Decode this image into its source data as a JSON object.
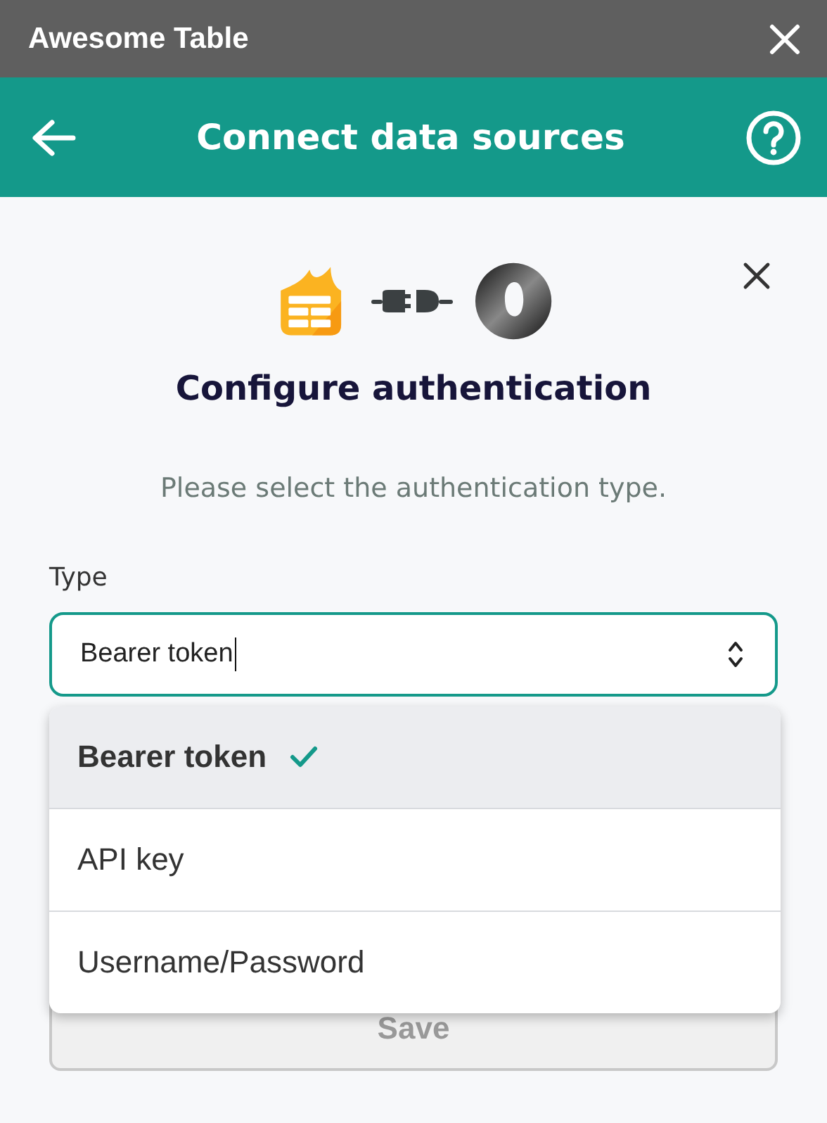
{
  "window": {
    "title": "Awesome Table"
  },
  "header": {
    "title": "Connect data sources"
  },
  "dialog": {
    "title": "Configure authentication",
    "subtitle": "Please select the authentication type.",
    "field": {
      "label": "Type",
      "value": "Bearer token",
      "focused": true
    },
    "options": [
      {
        "label": "Bearer token",
        "selected": true
      },
      {
        "label": "API key",
        "selected": false
      },
      {
        "label": "Username/Password",
        "selected": false
      }
    ],
    "save_button": {
      "label": "Save",
      "disabled": true
    }
  }
}
